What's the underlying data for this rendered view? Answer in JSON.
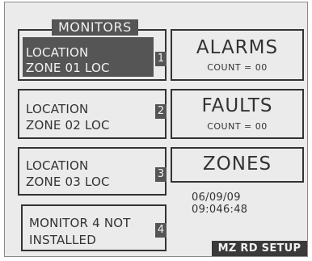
{
  "monitors_label": "MONITORS",
  "monitors": [
    {
      "line1": "LOCATION",
      "line2": "ZONE 01  LOC",
      "number": "1"
    },
    {
      "line1": "LOCATION",
      "line2": "ZONE 02  LOC",
      "number": "2"
    },
    {
      "line1": "LOCATION",
      "line2": "ZONE 03  LOC",
      "number": "3"
    },
    {
      "line1": "MONITOR 4 NOT",
      "line2": "INSTALLED",
      "number": "4"
    }
  ],
  "alarms": {
    "title": "ALARMS",
    "count": "COUNT = 00"
  },
  "faults": {
    "title": "FAULTS",
    "count": "COUNT = 00"
  },
  "zones": {
    "title": "ZONES"
  },
  "date": "06/09/09",
  "time": "09:046:48",
  "setup_button": "MZ RD SETUP"
}
